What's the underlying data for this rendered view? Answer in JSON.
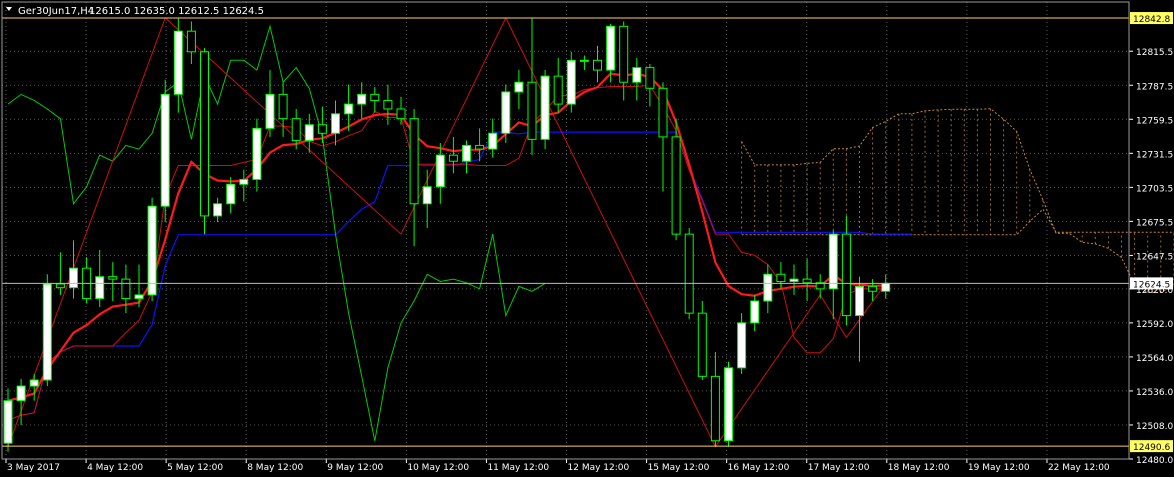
{
  "window": {
    "symbol_header": "Ger30Jun17,H4",
    "ohlc_header": "12615.0 12635.0 12612.5 12624.5"
  },
  "colors": {
    "background": "#000000",
    "axis_text": "#ffffff",
    "grid": "#5a5a5a",
    "bull_body": "#ffffff",
    "bear_body": "#000000",
    "wick": "#00ff00",
    "tenkan_line": "#ff0000",
    "kijun_line": "#1010ff",
    "chikou_line": "#00cc00",
    "kumo_fill": "#c8843c",
    "zigzag": "#cc1010",
    "ma_line": "#ff1a1a",
    "level_line": "#ffcc66",
    "price_marker_bg": "#ffff66",
    "current_price_bg": "#ffffff"
  },
  "chart_data": {
    "type": "candlestick",
    "timeframe": "H4",
    "ylim": [
      12480,
      12856
    ],
    "y_ticks": [
      12480.0,
      12508.0,
      12536.0,
      12564.0,
      12592.0,
      12620.0,
      12647.5,
      12675.5,
      12703.5,
      12731.5,
      12759.5,
      12787.5,
      12815.5
    ],
    "highlighted_prices": [
      {
        "value": "12842.8",
        "style": "marker"
      },
      {
        "value": "12490.6",
        "style": "marker"
      },
      {
        "value": "12624.5",
        "style": "current"
      }
    ],
    "x_labels": [
      "3 May 2017",
      "4 May 12:00",
      "5 May 12:00",
      "8 May 12:00",
      "9 May 12:00",
      "10 May 12:00",
      "11 May 12:00",
      "12 May 12:00",
      "15 May 12:00",
      "16 May 12:00",
      "17 May 12:00",
      "18 May 12:00",
      "19 May 12:00",
      "22 May 12:00"
    ],
    "candles": [
      {
        "o": 12493,
        "h": 12538,
        "l": 12486,
        "c": 12528
      },
      {
        "o": 12528,
        "h": 12546,
        "l": 12508,
        "c": 12540
      },
      {
        "o": 12540,
        "h": 12550,
        "l": 12528,
        "c": 12545
      },
      {
        "o": 12545,
        "h": 12632,
        "l": 12540,
        "c": 12624
      },
      {
        "o": 12624,
        "h": 12650,
        "l": 12615,
        "c": 12621
      },
      {
        "o": 12621,
        "h": 12660,
        "l": 12612,
        "c": 12637
      },
      {
        "o": 12637,
        "h": 12646,
        "l": 12608,
        "c": 12612
      },
      {
        "o": 12612,
        "h": 12652,
        "l": 12605,
        "c": 12630
      },
      {
        "o": 12630,
        "h": 12642,
        "l": 12610,
        "c": 12628
      },
      {
        "o": 12628,
        "h": 12640,
        "l": 12600,
        "c": 12612
      },
      {
        "o": 12612,
        "h": 12640,
        "l": 12605,
        "c": 12615
      },
      {
        "o": 12615,
        "h": 12695,
        "l": 12610,
        "c": 12688
      },
      {
        "o": 12688,
        "h": 12792,
        "l": 12675,
        "c": 12780
      },
      {
        "o": 12780,
        "h": 12843,
        "l": 12765,
        "c": 12832
      },
      {
        "o": 12832,
        "h": 12840,
        "l": 12805,
        "c": 12815
      },
      {
        "o": 12815,
        "h": 12818,
        "l": 12665,
        "c": 12680
      },
      {
        "o": 12680,
        "h": 12695,
        "l": 12675,
        "c": 12690
      },
      {
        "o": 12690,
        "h": 12712,
        "l": 12682,
        "c": 12706
      },
      {
        "o": 12706,
        "h": 12718,
        "l": 12692,
        "c": 12710
      },
      {
        "o": 12710,
        "h": 12760,
        "l": 12700,
        "c": 12752
      },
      {
        "o": 12752,
        "h": 12800,
        "l": 12745,
        "c": 12780
      },
      {
        "o": 12780,
        "h": 12790,
        "l": 12745,
        "c": 12760
      },
      {
        "o": 12760,
        "h": 12768,
        "l": 12735,
        "c": 12742
      },
      {
        "o": 12742,
        "h": 12764,
        "l": 12732,
        "c": 12755
      },
      {
        "o": 12755,
        "h": 12770,
        "l": 12740,
        "c": 12748
      },
      {
        "o": 12748,
        "h": 12775,
        "l": 12738,
        "c": 12764
      },
      {
        "o": 12764,
        "h": 12788,
        "l": 12750,
        "c": 12772
      },
      {
        "o": 12772,
        "h": 12790,
        "l": 12760,
        "c": 12780
      },
      {
        "o": 12780,
        "h": 12786,
        "l": 12765,
        "c": 12775
      },
      {
        "o": 12775,
        "h": 12788,
        "l": 12755,
        "c": 12768
      },
      {
        "o": 12768,
        "h": 12778,
        "l": 12755,
        "c": 12760
      },
      {
        "o": 12760,
        "h": 12768,
        "l": 12655,
        "c": 12690
      },
      {
        "o": 12690,
        "h": 12718,
        "l": 12670,
        "c": 12704
      },
      {
        "o": 12704,
        "h": 12740,
        "l": 12690,
        "c": 12730
      },
      {
        "o": 12730,
        "h": 12745,
        "l": 12715,
        "c": 12725
      },
      {
        "o": 12725,
        "h": 12742,
        "l": 12715,
        "c": 12738
      },
      {
        "o": 12738,
        "h": 12752,
        "l": 12725,
        "c": 12735
      },
      {
        "o": 12735,
        "h": 12760,
        "l": 12728,
        "c": 12748
      },
      {
        "o": 12748,
        "h": 12788,
        "l": 12740,
        "c": 12782
      },
      {
        "o": 12782,
        "h": 12800,
        "l": 12768,
        "c": 12790
      },
      {
        "o": 12790,
        "h": 12843,
        "l": 12730,
        "c": 12743
      },
      {
        "o": 12743,
        "h": 12800,
        "l": 12735,
        "c": 12795
      },
      {
        "o": 12795,
        "h": 12810,
        "l": 12765,
        "c": 12772
      },
      {
        "o": 12772,
        "h": 12815,
        "l": 12765,
        "c": 12808
      },
      {
        "o": 12808,
        "h": 12812,
        "l": 12800,
        "c": 12808
      },
      {
        "o": 12808,
        "h": 12820,
        "l": 12790,
        "c": 12800
      },
      {
        "o": 12800,
        "h": 12838,
        "l": 12790,
        "c": 12836
      },
      {
        "o": 12836,
        "h": 12840,
        "l": 12775,
        "c": 12790
      },
      {
        "o": 12790,
        "h": 12810,
        "l": 12775,
        "c": 12802
      },
      {
        "o": 12802,
        "h": 12805,
        "l": 12770,
        "c": 12785
      },
      {
        "o": 12785,
        "h": 12790,
        "l": 12700,
        "c": 12745
      },
      {
        "o": 12745,
        "h": 12760,
        "l": 12660,
        "c": 12665
      },
      {
        "o": 12665,
        "h": 12670,
        "l": 12595,
        "c": 12600
      },
      {
        "o": 12600,
        "h": 12610,
        "l": 12545,
        "c": 12548
      },
      {
        "o": 12548,
        "h": 12568,
        "l": 12490,
        "c": 12495
      },
      {
        "o": 12495,
        "h": 12560,
        "l": 12490,
        "c": 12555
      },
      {
        "o": 12555,
        "h": 12600,
        "l": 12550,
        "c": 12592
      },
      {
        "o": 12592,
        "h": 12615,
        "l": 12585,
        "c": 12610
      },
      {
        "o": 12610,
        "h": 12640,
        "l": 12600,
        "c": 12632
      },
      {
        "o": 12632,
        "h": 12642,
        "l": 12620,
        "c": 12626
      },
      {
        "o": 12626,
        "h": 12640,
        "l": 12615,
        "c": 12628
      },
      {
        "o": 12628,
        "h": 12645,
        "l": 12610,
        "c": 12625
      },
      {
        "o": 12625,
        "h": 12632,
        "l": 12612,
        "c": 12620
      },
      {
        "o": 12620,
        "h": 12668,
        "l": 12595,
        "c": 12665
      },
      {
        "o": 12665,
        "h": 12680,
        "l": 12590,
        "c": 12598
      },
      {
        "o": 12598,
        "h": 12630,
        "l": 12560,
        "c": 12622
      },
      {
        "o": 12622,
        "h": 12628,
        "l": 12610,
        "c": 12618
      },
      {
        "o": 12618,
        "h": 12632,
        "l": 12612,
        "c": 12624.5
      }
    ]
  }
}
